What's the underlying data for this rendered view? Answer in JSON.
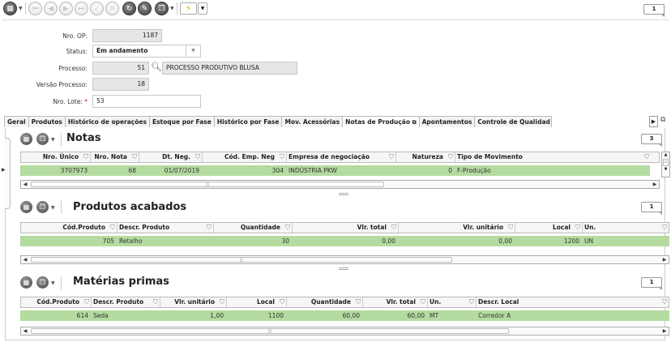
{
  "toolbar": {
    "page_indicator": "1",
    "buttons": [
      "grid-menu-icon",
      "first-record-icon",
      "previous-record-icon",
      "next-record-icon",
      "last-record-icon",
      "confirm-icon",
      "cancel-icon",
      "refresh-icon",
      "edit-icon",
      "clone-icon",
      "actions-icon"
    ]
  },
  "form": {
    "nro_op": {
      "label": "Nro. OP:",
      "value": "1187"
    },
    "status": {
      "label": "Status:",
      "value": "Em andamento"
    },
    "processo": {
      "label": "Processo:",
      "value": "51",
      "description": "PROCESSO PRODUTIVO BLUSA"
    },
    "versao_processo": {
      "label": "Versão Processo:",
      "value": "18"
    },
    "nro_lote": {
      "label": "Nro. Lote:",
      "required": "*",
      "value": "53"
    }
  },
  "tabs": [
    "Geral",
    "Produtos",
    "Histórico de operações",
    "Estoque por Fase",
    "Histórico por Fase",
    "Mov. Acessórias",
    "Notas de Produção",
    "Apontamentos",
    "Controle de Qualidad"
  ],
  "notas": {
    "title": "Notas",
    "page_indicator": "3",
    "columns": [
      "Nro. Único",
      "Nro. Nota",
      "Dt. Neg.",
      "Cód. Emp. Neg",
      "Empresa de negociação",
      "Natureza",
      "Tipo de Movimento"
    ],
    "rows": [
      [
        "3707973",
        "68",
        "01/07/2019",
        "304",
        "INDÚSTRIA PKW",
        "0",
        "F-Produção"
      ]
    ]
  },
  "produtos": {
    "title": "Produtos acabados",
    "page_indicator": "1",
    "columns": [
      "Cód.Produto",
      "Descr. Produto",
      "Quantidade",
      "Vlr. total",
      "Vlr. unitário",
      "Local",
      "Un."
    ],
    "rows": [
      [
        "705",
        "Retalho",
        "30",
        "0,00",
        "0,00",
        "1200",
        "UN"
      ]
    ]
  },
  "materias": {
    "title": "Matérias primas",
    "page_indicator": "1",
    "columns": [
      "Cód.Produto",
      "Descr. Produto",
      "Vlr. unitário",
      "Local",
      "Quantidade",
      "Vlr. total",
      "Un.",
      "Descr. Local"
    ],
    "rows": [
      [
        "614",
        "Seda",
        "1,00",
        "1100",
        "60,00",
        "60,00",
        "MT",
        "Corredor A"
      ]
    ]
  },
  "colors": {
    "selected_row": "#b4dba0",
    "accent": "#f2c200"
  }
}
